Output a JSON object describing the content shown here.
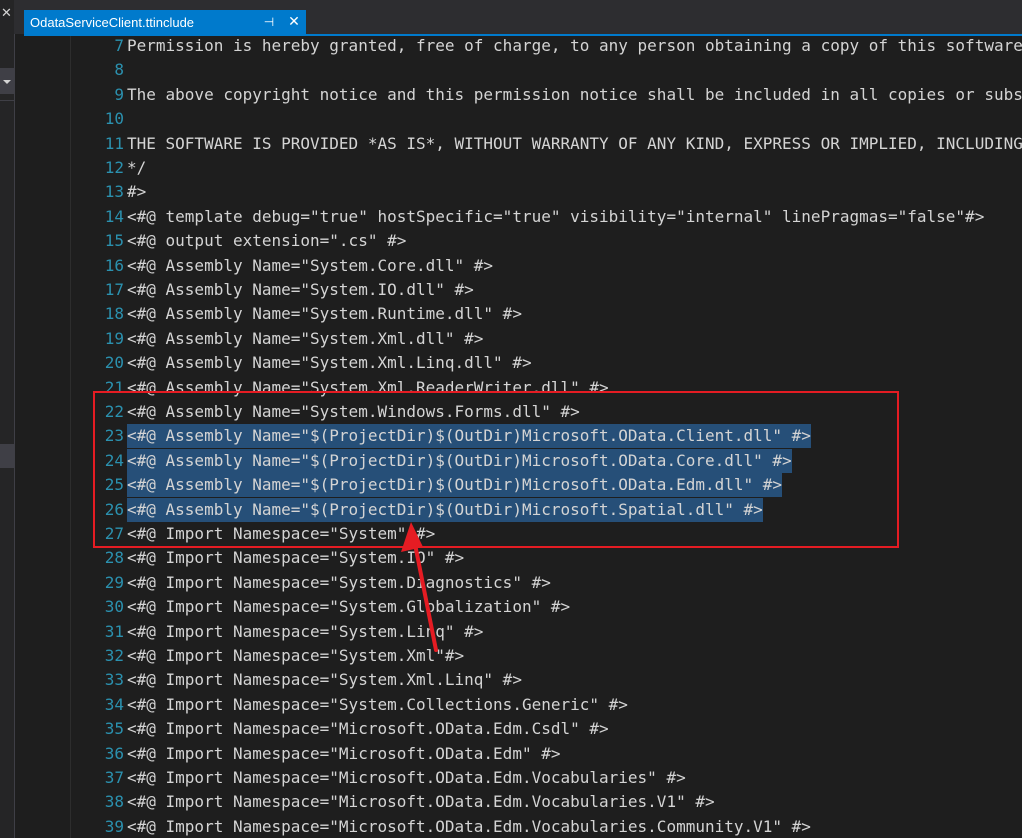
{
  "left_panel": {
    "close_glyph": "✕"
  },
  "tab": {
    "title": "OdataServiceClient.ttinclude",
    "pin_glyph": "⊣",
    "close_glyph": "✕"
  },
  "editor": {
    "lines": [
      {
        "n": "7",
        "text": "Permission is hereby granted, free of charge, to any person obtaining a copy of this software"
      },
      {
        "n": "8",
        "text": ""
      },
      {
        "n": "9",
        "text": "The above copyright notice and this permission notice shall be included in all copies or substantial"
      },
      {
        "n": "10",
        "text": ""
      },
      {
        "n": "11",
        "text": "THE SOFTWARE IS PROVIDED *AS IS*, WITHOUT WARRANTY OF ANY KIND, EXPRESS OR IMPLIED, INCLUDING"
      },
      {
        "n": "12",
        "text": "*/"
      },
      {
        "n": "13",
        "text": "#>"
      },
      {
        "n": "14",
        "text": "<#@ template debug=\"true\" hostSpecific=\"true\" visibility=\"internal\" linePragmas=\"false\"#>"
      },
      {
        "n": "15",
        "text": "<#@ output extension=\".cs\" #>"
      },
      {
        "n": "16",
        "text": "<#@ Assembly Name=\"System.Core.dll\" #>"
      },
      {
        "n": "17",
        "text": "<#@ Assembly Name=\"System.IO.dll\" #>"
      },
      {
        "n": "18",
        "text": "<#@ Assembly Name=\"System.Runtime.dll\" #>"
      },
      {
        "n": "19",
        "text": "<#@ Assembly Name=\"System.Xml.dll\" #>"
      },
      {
        "n": "20",
        "text": "<#@ Assembly Name=\"System.Xml.Linq.dll\" #>"
      },
      {
        "n": "21",
        "text": "<#@ Assembly Name=\"System.Xml.ReaderWriter.dll\" #>"
      },
      {
        "n": "22",
        "text": "<#@ Assembly Name=\"System.Windows.Forms.dll\" #>"
      },
      {
        "n": "23",
        "text": "<#@ Assembly Name=\"$(ProjectDir)$(OutDir)Microsoft.OData.Client.dll\" #>",
        "selected": true
      },
      {
        "n": "24",
        "text": "<#@ Assembly Name=\"$(ProjectDir)$(OutDir)Microsoft.OData.Core.dll\" #>",
        "selected": true
      },
      {
        "n": "25",
        "text": "<#@ Assembly Name=\"$(ProjectDir)$(OutDir)Microsoft.OData.Edm.dll\" #>",
        "selected": true
      },
      {
        "n": "26",
        "text": "<#@ Assembly Name=\"$(ProjectDir)$(OutDir)Microsoft.Spatial.dll\" #>",
        "selected": true
      },
      {
        "n": "27",
        "text": "<#@ Import Namespace=\"System\" #>"
      },
      {
        "n": "28",
        "text": "<#@ Import Namespace=\"System.IO\" #>"
      },
      {
        "n": "29",
        "text": "<#@ Import Namespace=\"System.Diagnostics\" #>"
      },
      {
        "n": "30",
        "text": "<#@ Import Namespace=\"System.Globalization\" #>"
      },
      {
        "n": "31",
        "text": "<#@ Import Namespace=\"System.Linq\" #>"
      },
      {
        "n": "32",
        "text": "<#@ Import Namespace=\"System.Xml\"#>"
      },
      {
        "n": "33",
        "text": "<#@ Import Namespace=\"System.Xml.Linq\" #>"
      },
      {
        "n": "34",
        "text": "<#@ Import Namespace=\"System.Collections.Generic\" #>"
      },
      {
        "n": "35",
        "text": "<#@ Import Namespace=\"Microsoft.OData.Edm.Csdl\" #>"
      },
      {
        "n": "36",
        "text": "<#@ Import Namespace=\"Microsoft.OData.Edm\" #>"
      },
      {
        "n": "37",
        "text": "<#@ Import Namespace=\"Microsoft.OData.Edm.Vocabularies\" #>"
      },
      {
        "n": "38",
        "text": "<#@ Import Namespace=\"Microsoft.OData.Edm.Vocabularies.V1\" #>"
      },
      {
        "n": "39",
        "text": "<#@ Import Namespace=\"Microsoft.OData.Edm.Vocabularies.Community.V1\" #>"
      }
    ]
  },
  "colors": {
    "background": "#1e1e1e",
    "line_number": "#2b91af",
    "code_text": "#d4d4d4",
    "selection": "#264f78",
    "tab_active": "#007acc",
    "annotation": "#e51c23"
  }
}
